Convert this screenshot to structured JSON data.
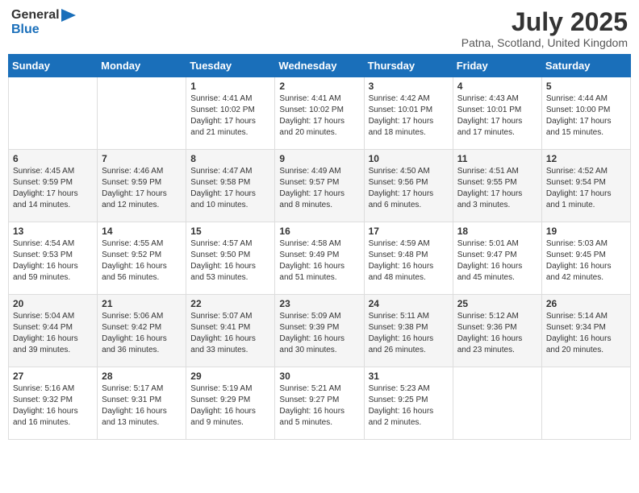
{
  "logo": {
    "general": "General",
    "blue": "Blue"
  },
  "title": "July 2025",
  "subtitle": "Patna, Scotland, United Kingdom",
  "days_of_week": [
    "Sunday",
    "Monday",
    "Tuesday",
    "Wednesday",
    "Thursday",
    "Friday",
    "Saturday"
  ],
  "weeks": [
    [
      {
        "day": "",
        "sunrise": "",
        "sunset": "",
        "daylight": ""
      },
      {
        "day": "",
        "sunrise": "",
        "sunset": "",
        "daylight": ""
      },
      {
        "day": "1",
        "sunrise": "Sunrise: 4:41 AM",
        "sunset": "Sunset: 10:02 PM",
        "daylight": "Daylight: 17 hours and 21 minutes."
      },
      {
        "day": "2",
        "sunrise": "Sunrise: 4:41 AM",
        "sunset": "Sunset: 10:02 PM",
        "daylight": "Daylight: 17 hours and 20 minutes."
      },
      {
        "day": "3",
        "sunrise": "Sunrise: 4:42 AM",
        "sunset": "Sunset: 10:01 PM",
        "daylight": "Daylight: 17 hours and 18 minutes."
      },
      {
        "day": "4",
        "sunrise": "Sunrise: 4:43 AM",
        "sunset": "Sunset: 10:01 PM",
        "daylight": "Daylight: 17 hours and 17 minutes."
      },
      {
        "day": "5",
        "sunrise": "Sunrise: 4:44 AM",
        "sunset": "Sunset: 10:00 PM",
        "daylight": "Daylight: 17 hours and 15 minutes."
      }
    ],
    [
      {
        "day": "6",
        "sunrise": "Sunrise: 4:45 AM",
        "sunset": "Sunset: 9:59 PM",
        "daylight": "Daylight: 17 hours and 14 minutes."
      },
      {
        "day": "7",
        "sunrise": "Sunrise: 4:46 AM",
        "sunset": "Sunset: 9:59 PM",
        "daylight": "Daylight: 17 hours and 12 minutes."
      },
      {
        "day": "8",
        "sunrise": "Sunrise: 4:47 AM",
        "sunset": "Sunset: 9:58 PM",
        "daylight": "Daylight: 17 hours and 10 minutes."
      },
      {
        "day": "9",
        "sunrise": "Sunrise: 4:49 AM",
        "sunset": "Sunset: 9:57 PM",
        "daylight": "Daylight: 17 hours and 8 minutes."
      },
      {
        "day": "10",
        "sunrise": "Sunrise: 4:50 AM",
        "sunset": "Sunset: 9:56 PM",
        "daylight": "Daylight: 17 hours and 6 minutes."
      },
      {
        "day": "11",
        "sunrise": "Sunrise: 4:51 AM",
        "sunset": "Sunset: 9:55 PM",
        "daylight": "Daylight: 17 hours and 3 minutes."
      },
      {
        "day": "12",
        "sunrise": "Sunrise: 4:52 AM",
        "sunset": "Sunset: 9:54 PM",
        "daylight": "Daylight: 17 hours and 1 minute."
      }
    ],
    [
      {
        "day": "13",
        "sunrise": "Sunrise: 4:54 AM",
        "sunset": "Sunset: 9:53 PM",
        "daylight": "Daylight: 16 hours and 59 minutes."
      },
      {
        "day": "14",
        "sunrise": "Sunrise: 4:55 AM",
        "sunset": "Sunset: 9:52 PM",
        "daylight": "Daylight: 16 hours and 56 minutes."
      },
      {
        "day": "15",
        "sunrise": "Sunrise: 4:57 AM",
        "sunset": "Sunset: 9:50 PM",
        "daylight": "Daylight: 16 hours and 53 minutes."
      },
      {
        "day": "16",
        "sunrise": "Sunrise: 4:58 AM",
        "sunset": "Sunset: 9:49 PM",
        "daylight": "Daylight: 16 hours and 51 minutes."
      },
      {
        "day": "17",
        "sunrise": "Sunrise: 4:59 AM",
        "sunset": "Sunset: 9:48 PM",
        "daylight": "Daylight: 16 hours and 48 minutes."
      },
      {
        "day": "18",
        "sunrise": "Sunrise: 5:01 AM",
        "sunset": "Sunset: 9:47 PM",
        "daylight": "Daylight: 16 hours and 45 minutes."
      },
      {
        "day": "19",
        "sunrise": "Sunrise: 5:03 AM",
        "sunset": "Sunset: 9:45 PM",
        "daylight": "Daylight: 16 hours and 42 minutes."
      }
    ],
    [
      {
        "day": "20",
        "sunrise": "Sunrise: 5:04 AM",
        "sunset": "Sunset: 9:44 PM",
        "daylight": "Daylight: 16 hours and 39 minutes."
      },
      {
        "day": "21",
        "sunrise": "Sunrise: 5:06 AM",
        "sunset": "Sunset: 9:42 PM",
        "daylight": "Daylight: 16 hours and 36 minutes."
      },
      {
        "day": "22",
        "sunrise": "Sunrise: 5:07 AM",
        "sunset": "Sunset: 9:41 PM",
        "daylight": "Daylight: 16 hours and 33 minutes."
      },
      {
        "day": "23",
        "sunrise": "Sunrise: 5:09 AM",
        "sunset": "Sunset: 9:39 PM",
        "daylight": "Daylight: 16 hours and 30 minutes."
      },
      {
        "day": "24",
        "sunrise": "Sunrise: 5:11 AM",
        "sunset": "Sunset: 9:38 PM",
        "daylight": "Daylight: 16 hours and 26 minutes."
      },
      {
        "day": "25",
        "sunrise": "Sunrise: 5:12 AM",
        "sunset": "Sunset: 9:36 PM",
        "daylight": "Daylight: 16 hours and 23 minutes."
      },
      {
        "day": "26",
        "sunrise": "Sunrise: 5:14 AM",
        "sunset": "Sunset: 9:34 PM",
        "daylight": "Daylight: 16 hours and 20 minutes."
      }
    ],
    [
      {
        "day": "27",
        "sunrise": "Sunrise: 5:16 AM",
        "sunset": "Sunset: 9:32 PM",
        "daylight": "Daylight: 16 hours and 16 minutes."
      },
      {
        "day": "28",
        "sunrise": "Sunrise: 5:17 AM",
        "sunset": "Sunset: 9:31 PM",
        "daylight": "Daylight: 16 hours and 13 minutes."
      },
      {
        "day": "29",
        "sunrise": "Sunrise: 5:19 AM",
        "sunset": "Sunset: 9:29 PM",
        "daylight": "Daylight: 16 hours and 9 minutes."
      },
      {
        "day": "30",
        "sunrise": "Sunrise: 5:21 AM",
        "sunset": "Sunset: 9:27 PM",
        "daylight": "Daylight: 16 hours and 5 minutes."
      },
      {
        "day": "31",
        "sunrise": "Sunrise: 5:23 AM",
        "sunset": "Sunset: 9:25 PM",
        "daylight": "Daylight: 16 hours and 2 minutes."
      },
      {
        "day": "",
        "sunrise": "",
        "sunset": "",
        "daylight": ""
      },
      {
        "day": "",
        "sunrise": "",
        "sunset": "",
        "daylight": ""
      }
    ]
  ]
}
